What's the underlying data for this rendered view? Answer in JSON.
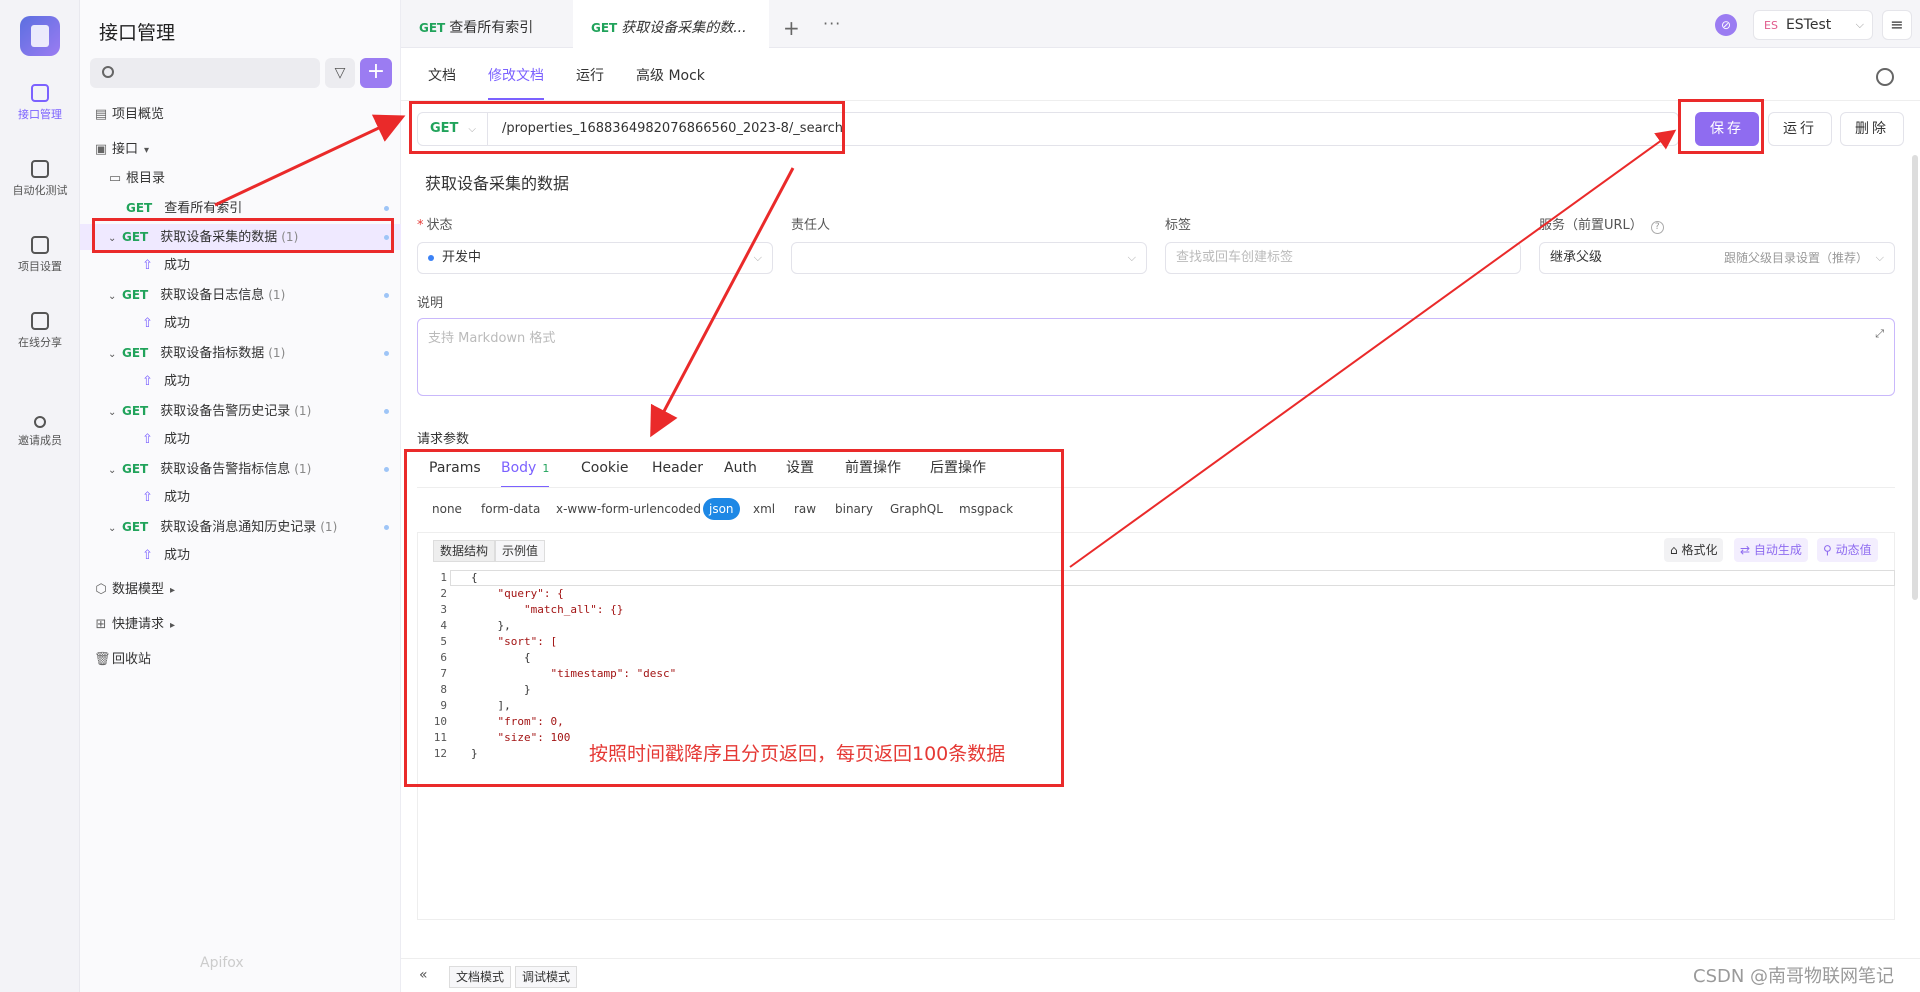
{
  "rail": {
    "items": [
      {
        "label": "接口管理",
        "icon": "api-icon",
        "active": true
      },
      {
        "label": "自动化测试",
        "icon": "automation-icon"
      },
      {
        "label": "项目设置",
        "icon": "settings-icon"
      },
      {
        "label": "在线分享",
        "icon": "share-icon"
      },
      {
        "label": "邀请成员",
        "icon": "invite-icon"
      }
    ]
  },
  "sidebar": {
    "title": "接口管理",
    "filter_icon": "filter-icon",
    "add_label": "+",
    "overview": "项目概览",
    "api_root": "接口",
    "root_dir": "根目录",
    "apis": [
      {
        "method": "GET",
        "name": "查看所有索引"
      },
      {
        "method": "GET",
        "name": "获取设备采集的数据",
        "count": "(1)",
        "response": "成功"
      },
      {
        "method": "GET",
        "name": "获取设备日志信息",
        "count": "(1)",
        "response": "成功"
      },
      {
        "method": "GET",
        "name": "获取设备指标数据",
        "count": "(1)",
        "response": "成功"
      },
      {
        "method": "GET",
        "name": "获取设备告警历史记录",
        "count": "(1)",
        "response": "成功"
      },
      {
        "method": "GET",
        "name": "获取设备告警指标信息",
        "count": "(1)",
        "response": "成功"
      },
      {
        "method": "GET",
        "name": "获取设备消息通知历史记录",
        "count": "(1)",
        "response": "成功"
      }
    ],
    "data_model": "数据模型",
    "quick_request": "快捷请求",
    "recycle_bin": "回收站",
    "brand": "Apifox"
  },
  "tabs": [
    {
      "method": "GET",
      "label": "查看所有索引"
    },
    {
      "method": "GET",
      "label": "获取设备采集的数..."
    }
  ],
  "header": {
    "plus": "+",
    "more": "···",
    "env_badge": "ES",
    "env_name": "ESTest",
    "menu": "≡"
  },
  "subtabs": [
    "文档",
    "修改文档",
    "运行",
    "高级 Mock"
  ],
  "request": {
    "method": "GET",
    "url": "/properties_1688364982076866560_2023-8/_search",
    "save": "保存",
    "run": "运行",
    "delete": "删除"
  },
  "form": {
    "name": "获取设备采集的数据",
    "status_label": "状态",
    "status_value": "开发中",
    "owner_label": "责任人",
    "tags_label": "标签",
    "tags_placeholder": "查找或回车创建标签",
    "service_label": "服务（前置URL）",
    "service_value": "继承父级",
    "service_hint": "跟随父级目录设置（推荐）",
    "desc_label": "说明",
    "desc_placeholder": "支持 Markdown 格式"
  },
  "params": {
    "label": "请求参数",
    "tabs": [
      "Params",
      "Body",
      "Cookie",
      "Header",
      "Auth",
      "设置",
      "前置操作",
      "后置操作"
    ],
    "body_badge": "1",
    "body_types": [
      "none",
      "form-data",
      "x-www-form-urlencoded",
      "json",
      "xml",
      "raw",
      "binary",
      "GraphQL",
      "msgpack"
    ],
    "seg_schema": "数据结构",
    "seg_example": "示例值",
    "format_btn": "格式化",
    "autogen_btn": "自动生成",
    "dynamic_btn": "动态值"
  },
  "code": [
    {
      "n": "1",
      "t": "{"
    },
    {
      "n": "2",
      "t": "    \"query\": {"
    },
    {
      "n": "3",
      "t": "        \"match_all\": {}"
    },
    {
      "n": "4",
      "t": "    },"
    },
    {
      "n": "5",
      "t": "    \"sort\": ["
    },
    {
      "n": "6",
      "t": "        {"
    },
    {
      "n": "7",
      "t": "            \"timestamp\": \"desc\""
    },
    {
      "n": "8",
      "t": "        }"
    },
    {
      "n": "9",
      "t": "    ],"
    },
    {
      "n": "10",
      "t": "    \"from\": 0,"
    },
    {
      "n": "11",
      "t": "    \"size\": 100"
    },
    {
      "n": "12",
      "t": "}"
    }
  ],
  "annotation": "按照时间戳降序且分页返回，每页返回100条数据",
  "bottom": {
    "doc_mode": "文档模式",
    "debug_mode": "调试模式",
    "collapse": "«"
  },
  "watermark": "CSDN @南哥物联网笔记",
  "colors": {
    "accent": "#8f6cf0",
    "get": "#21a35b",
    "annotation": "#ea2a2a"
  }
}
